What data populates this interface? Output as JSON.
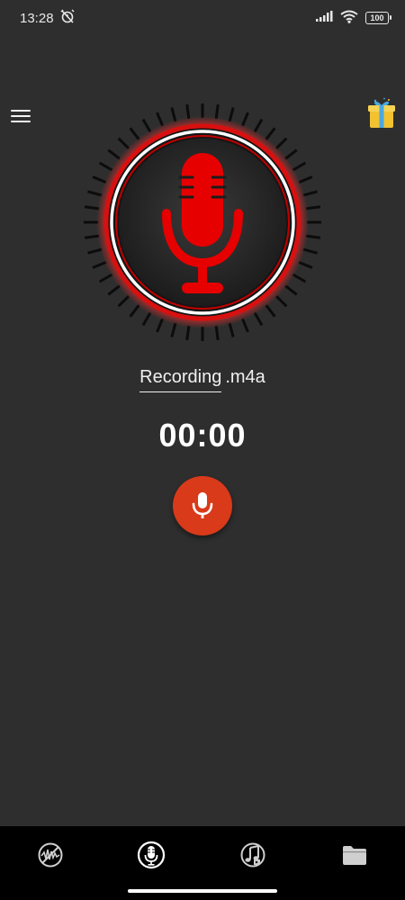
{
  "status_bar": {
    "time": "13:28",
    "battery_level": "100",
    "icons": [
      "alarm-off-icon",
      "signal-icon",
      "wifi-icon",
      "battery-icon"
    ]
  },
  "header": {
    "menu_icon": "hamburger-menu-icon",
    "gift_icon": "gift-icon"
  },
  "recorder": {
    "visual_icon": "microphone-icon",
    "file_name": "Recording",
    "file_extension": ".m4a",
    "timer": "00:00",
    "record_button_icon": "microphone-icon"
  },
  "bottom_nav": {
    "items": [
      {
        "icon": "waveform-off-icon"
      },
      {
        "icon": "microphone-icon",
        "active": true
      },
      {
        "icon": "music-note-icon"
      },
      {
        "icon": "folder-icon"
      }
    ]
  },
  "colors": {
    "background": "#2e2e2e",
    "accent_red": "#e00000",
    "record_button": "#d93a1a",
    "nav_background": "#000000"
  }
}
